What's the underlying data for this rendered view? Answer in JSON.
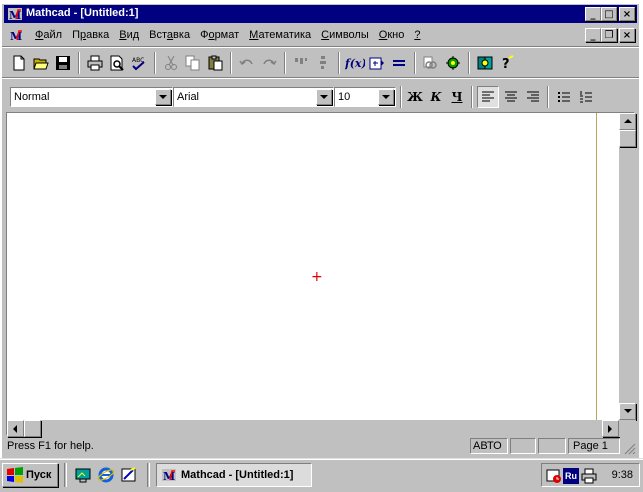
{
  "window": {
    "title": "Mathcad  - [Untitled:1]",
    "caption_buttons": {
      "minimize": "_",
      "maximize": "□",
      "close": "×"
    },
    "mdi_buttons": {
      "minimize": "_",
      "restore": "❐",
      "close": "×"
    }
  },
  "menu": {
    "items": [
      {
        "pre": "",
        "ul": "Ф",
        "post": "айл"
      },
      {
        "pre": "П",
        "ul": "р",
        "post": "авка"
      },
      {
        "pre": "",
        "ul": "В",
        "post": "ид"
      },
      {
        "pre": "Вст",
        "ul": "а",
        "post": "вка"
      },
      {
        "pre": "Ф",
        "ul": "о",
        "post": "рмат"
      },
      {
        "pre": "",
        "ul": "М",
        "post": "атематика"
      },
      {
        "pre": "",
        "ul": "С",
        "post": "имволы"
      },
      {
        "pre": "",
        "ul": "О",
        "post": "кно"
      },
      {
        "pre": "",
        "ul": "?",
        "post": ""
      }
    ]
  },
  "toolbar": {
    "icons": [
      "new-icon",
      "open-icon",
      "save-icon",
      "print-icon",
      "print-preview-icon",
      "spell-check-icon",
      "cut-icon",
      "copy-icon",
      "paste-icon",
      "undo-icon",
      "redo-icon",
      "align-across-icon",
      "align-down-icon",
      "insert-function-icon",
      "insert-unit-icon",
      "calculate-icon",
      "insert-hyperlink-icon",
      "insert-component-icon",
      "resource-center-icon",
      "help-icon"
    ]
  },
  "format_bar": {
    "style": "Normal",
    "font": "Arial",
    "size": "10",
    "bold": "Ж",
    "italic": "К",
    "underline": "Ч"
  },
  "status": {
    "help_text": "Press F1 for help.",
    "mode": "АВТО",
    "page": "Page 1"
  },
  "taskbar": {
    "start_label": "Пуск",
    "task_label": "Mathcad  - [Untitled:1]",
    "lang": "Ru",
    "clock": "9:38"
  },
  "colors": {
    "title_bar": "#000080",
    "face": "#c0c0c0",
    "cursor": "#e00000",
    "right_margin": "#b8a45a"
  }
}
